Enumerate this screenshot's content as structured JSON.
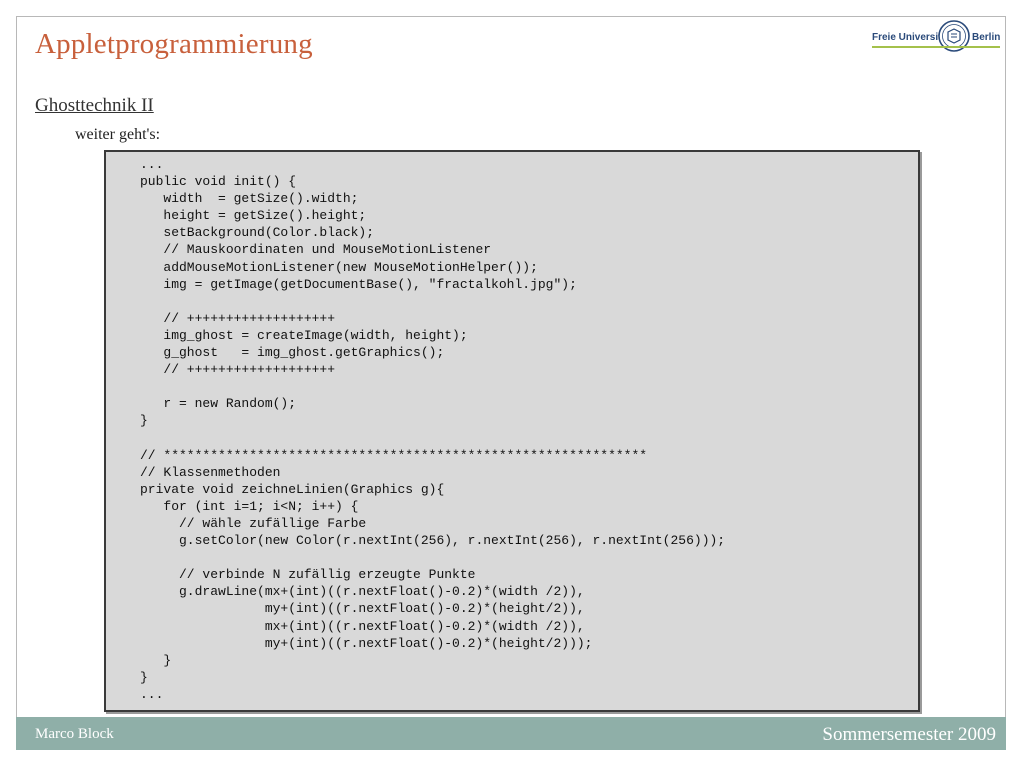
{
  "header": {
    "title": "Appletprogrammierung",
    "logo": {
      "text_left": "Freie Universität",
      "text_right": "Berlin",
      "seal_icon": "university-seal-icon",
      "underline_color": "#a4c14b"
    }
  },
  "content": {
    "subtitle": "Ghosttechnik II",
    "bullet": "weiter geht's:",
    "code_lines": [
      "...",
      "public void init() {",
      "   width  = getSize().width;",
      "   height = getSize().height;",
      "   setBackground(Color.black);",
      "   // Mauskoordinaten und MouseMotionListener",
      "   addMouseMotionListener(new MouseMotionHelper());",
      "   img = getImage(getDocumentBase(), \"fractalkohl.jpg\");",
      "",
      "   // +++++++++++++++++++",
      "   img_ghost = createImage(width, height);",
      "   g_ghost   = img_ghost.getGraphics();",
      "   // +++++++++++++++++++",
      "",
      "   r = new Random();",
      "}",
      "",
      "// **************************************************************",
      "// Klassenmethoden",
      "private void zeichneLinien(Graphics g){",
      "   for (int i=1; i<N; i++) {",
      "     // wähle zufällige Farbe",
      "     g.setColor(new Color(r.nextInt(256), r.nextInt(256), r.nextInt(256)));",
      "",
      "     // verbinde N zufällig erzeugte Punkte",
      "     g.drawLine(mx+(int)((r.nextFloat()-0.2)*(width /2)),",
      "                my+(int)((r.nextFloat()-0.2)*(height/2)),",
      "                mx+(int)((r.nextFloat()-0.2)*(width /2)),",
      "                my+(int)((r.nextFloat()-0.2)*(height/2)));",
      "   }",
      "}",
      "..."
    ]
  },
  "footer": {
    "author": "Marco Block",
    "semester": "Sommersemester 2009",
    "bar_color": "#8fafa8"
  },
  "colors": {
    "title": "#c8603c",
    "code_background": "#d9d9d9"
  }
}
